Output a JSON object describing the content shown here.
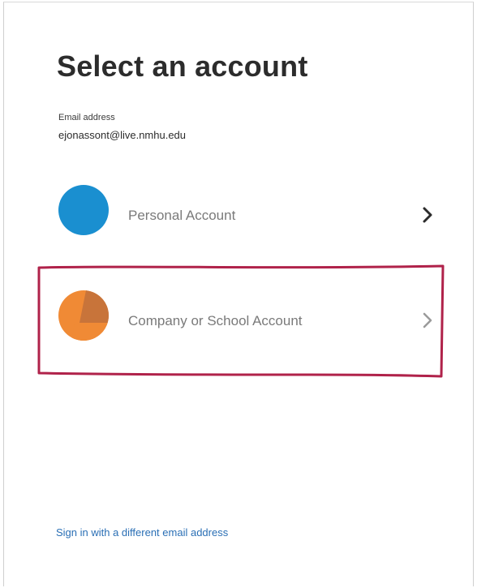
{
  "page": {
    "title": "Select an account"
  },
  "email": {
    "label": "Email address",
    "value": "ejonassont@live.nmhu.edu"
  },
  "accounts": [
    {
      "label": "Personal Account",
      "avatar_icon": "personal-account-icon",
      "avatar_color": "#1a8fd0",
      "chevron_icon": "chevron-right-icon"
    },
    {
      "label": "Company or School Account",
      "avatar_icon": "company-account-icon",
      "avatar_color": "#f08a35",
      "chevron_icon": "chevron-right-icon"
    }
  ],
  "annotation": {
    "color": "#b0224a"
  },
  "footer": {
    "signin_link": "Sign in with a different email address"
  }
}
